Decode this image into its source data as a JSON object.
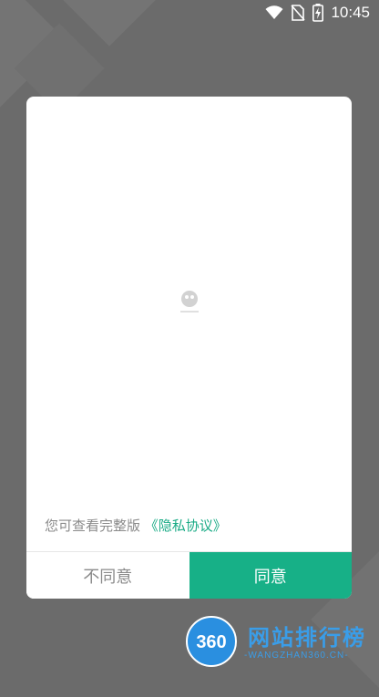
{
  "status_bar": {
    "time": "10:45",
    "icons": [
      "wifi-icon",
      "no-sim-icon",
      "battery-charging-icon"
    ]
  },
  "dialog": {
    "policy_prefix": "您可查看完整版",
    "policy_link": "《隐私协议》",
    "buttons": {
      "disagree": "不同意",
      "agree": "同意"
    },
    "logo": "loading-logo-icon"
  },
  "watermark": {
    "badge": "360",
    "title": "网站排行榜",
    "subtitle": "-WANGZHAN360.CN-"
  },
  "colors": {
    "overlay": "#6b6b6b",
    "accent": "#17b087",
    "link": "#1aab86",
    "muted_text": "#8a8a8a",
    "watermark_blue": "#3a9de8"
  }
}
